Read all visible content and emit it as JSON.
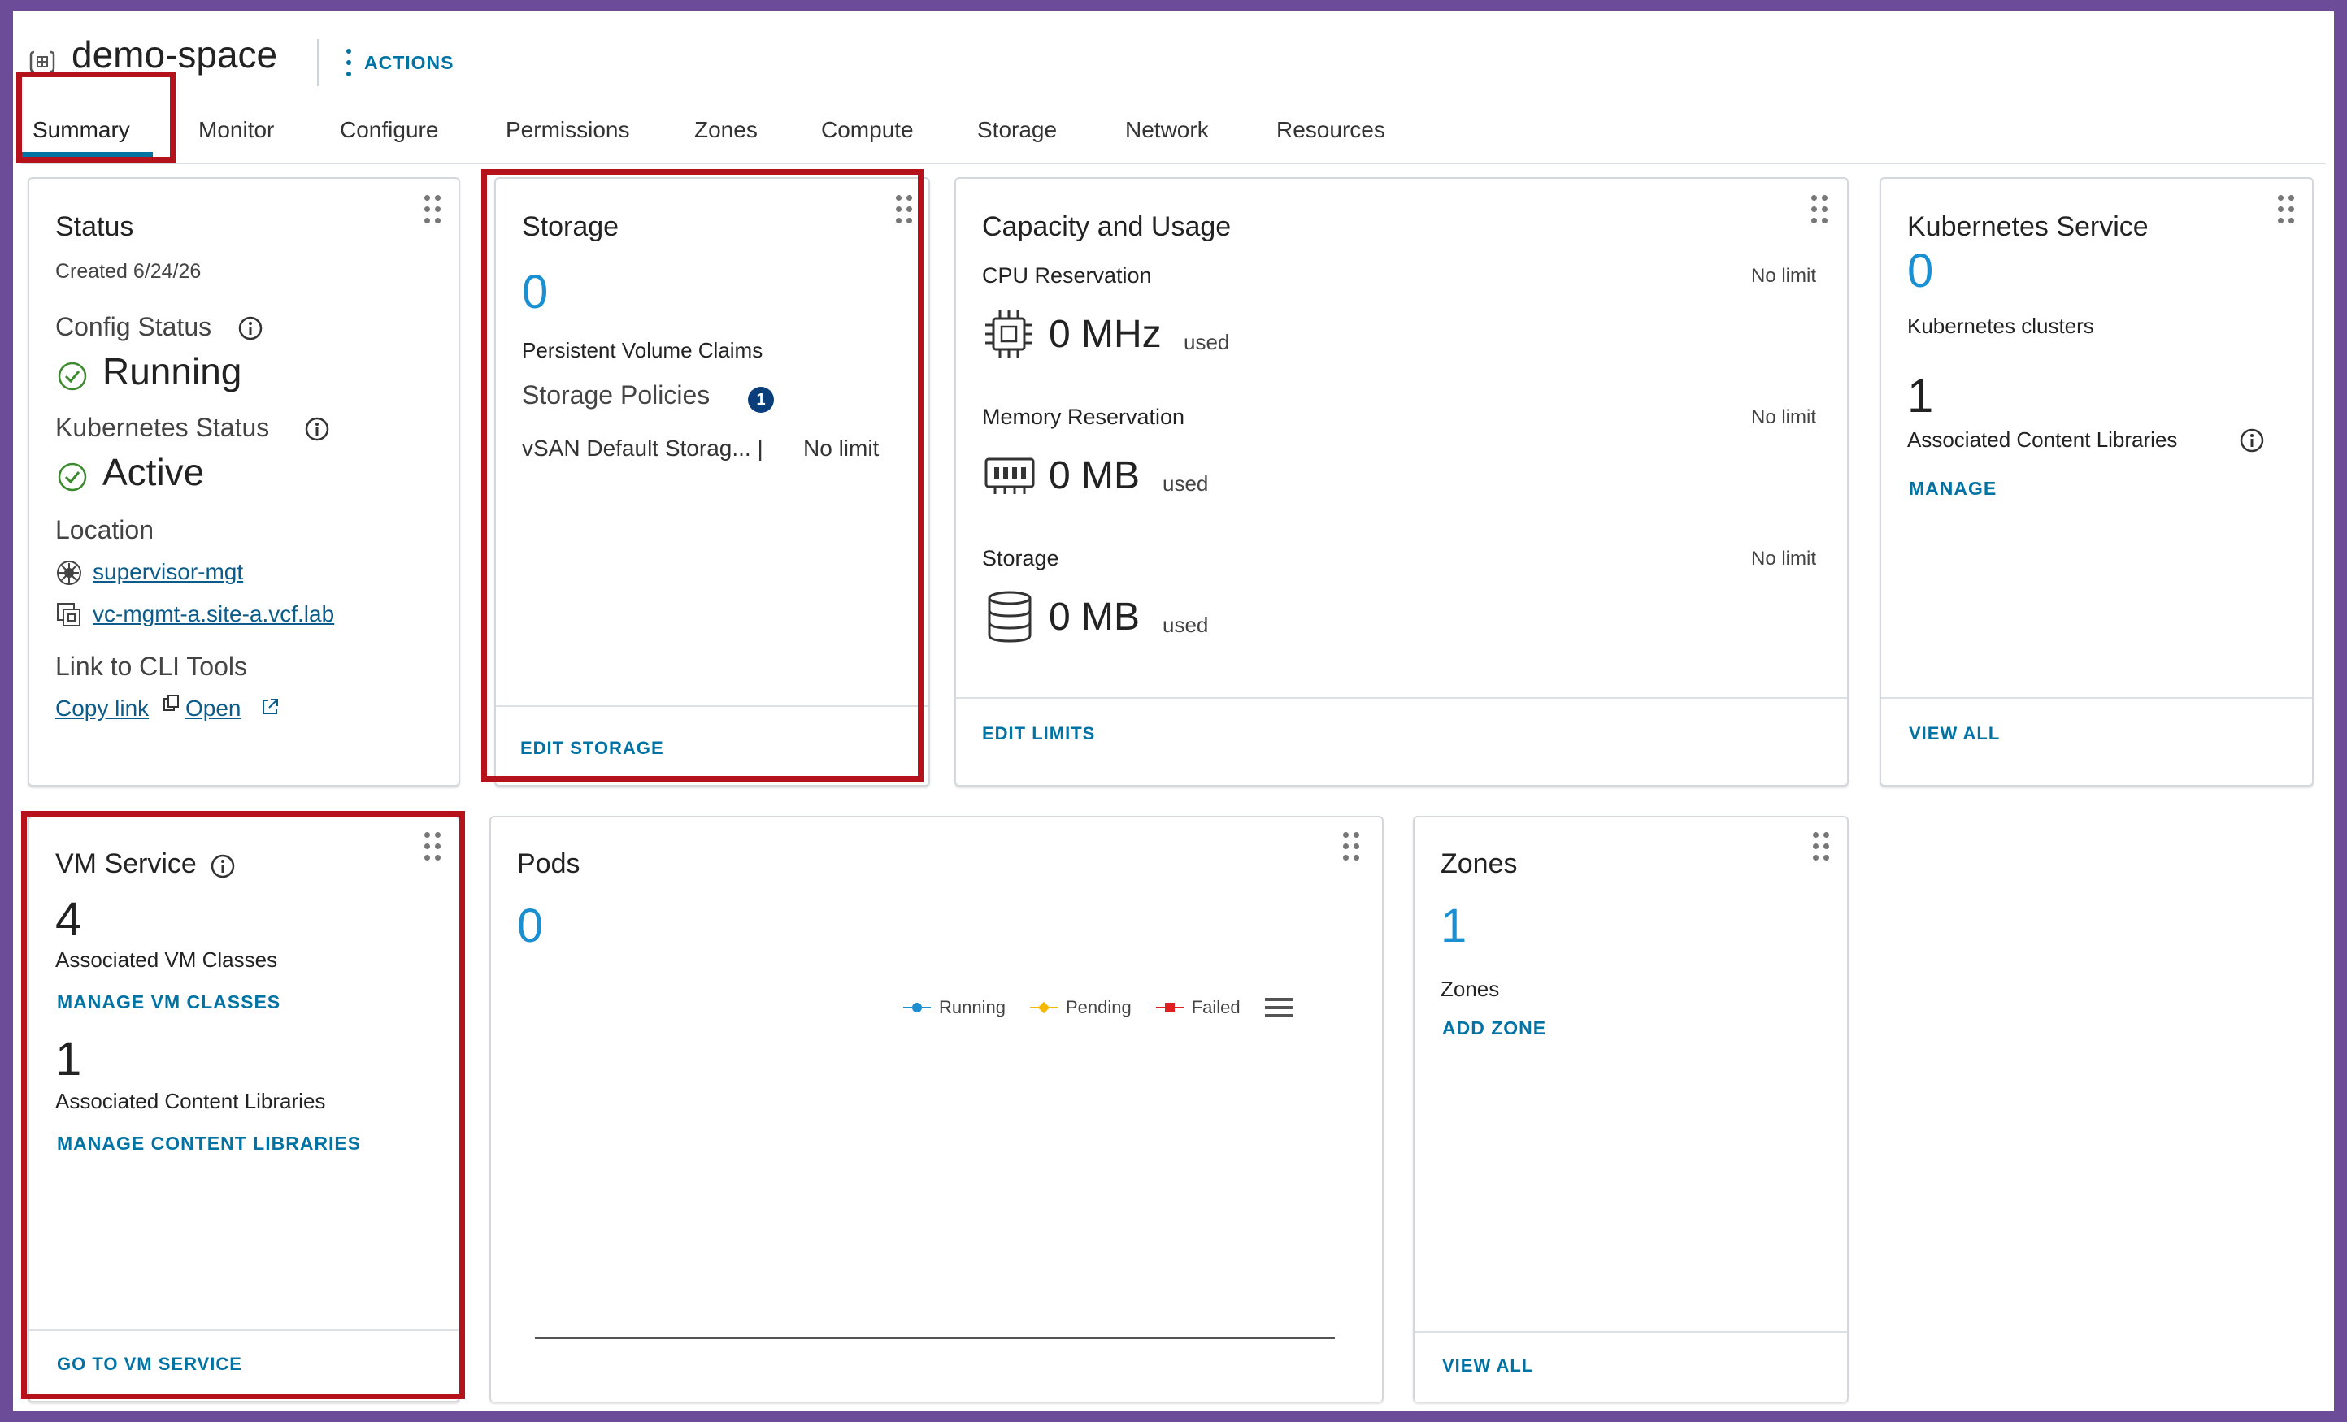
{
  "header": {
    "title": "demo-space",
    "actions_label": "ACTIONS"
  },
  "tabs": [
    {
      "label": "Summary",
      "active": true
    },
    {
      "label": "Monitor"
    },
    {
      "label": "Configure"
    },
    {
      "label": "Permissions"
    },
    {
      "label": "Zones"
    },
    {
      "label": "Compute"
    },
    {
      "label": "Storage"
    },
    {
      "label": "Network"
    },
    {
      "label": "Resources"
    }
  ],
  "status_card": {
    "title": "Status",
    "created": "Created 6/24/26",
    "config_status_label": "Config Status",
    "config_status_value": "Running",
    "k8s_status_label": "Kubernetes Status",
    "k8s_status_value": "Active",
    "location_label": "Location",
    "location_supervisor": "supervisor-mgt",
    "location_vcenter": "vc-mgmt-a.site-a.vcf.lab",
    "cli_label": "Link to CLI Tools",
    "copy_link": "Copy link",
    "open_link": "Open"
  },
  "storage_card": {
    "title": "Storage",
    "pvc_count": "0",
    "pvc_label": "Persistent Volume Claims",
    "policies_label": "Storage Policies",
    "policies_badge": "1",
    "policy_name": "vSAN Default Storag... |",
    "policy_limit": "No limit",
    "footer_action": "EDIT STORAGE"
  },
  "capacity_card": {
    "title": "Capacity and Usage",
    "cpu_label": "CPU Reservation",
    "cpu_limit": "No limit",
    "cpu_value": "0 MHz",
    "cpu_used": "used",
    "memory_label": "Memory Reservation",
    "memory_limit": "No limit",
    "memory_value": "0 MB",
    "memory_used": "used",
    "storage_label": "Storage",
    "storage_limit": "No limit",
    "storage_value": "0 MB",
    "storage_used": "used",
    "footer_action": "EDIT LIMITS"
  },
  "k8s_card": {
    "title": "Kubernetes Service",
    "clusters_count": "0",
    "clusters_label": "Kubernetes clusters",
    "libraries_count": "1",
    "libraries_label": "Associated Content Libraries",
    "manage_action": "MANAGE",
    "footer_action": "VIEW ALL"
  },
  "vm_card": {
    "title": "VM Service",
    "classes_count": "4",
    "classes_label": "Associated VM Classes",
    "manage_classes": "MANAGE VM CLASSES",
    "libraries_count": "1",
    "libraries_label": "Associated Content Libraries",
    "manage_libraries": "MANAGE CONTENT LIBRARIES",
    "footer_action": "GO TO VM SERVICE"
  },
  "pods_card": {
    "title": "Pods",
    "count": "0",
    "legend": [
      {
        "label": "Running",
        "color": "#1a8fd2",
        "marker": "circle"
      },
      {
        "label": "Pending",
        "color": "#f5b800",
        "marker": "diamond"
      },
      {
        "label": "Failed",
        "color": "#e02020",
        "marker": "square"
      }
    ]
  },
  "zones_card": {
    "title": "Zones",
    "count": "1",
    "label": "Zones",
    "add_action": "ADD ZONE",
    "footer_action": "VIEW ALL"
  },
  "colors": {
    "accent": "#0072a3",
    "count_blue": "#1a8fd2",
    "ok_green": "#3c8a2e",
    "highlight_red": "#b5121b",
    "border_purple": "#6c4b98"
  }
}
